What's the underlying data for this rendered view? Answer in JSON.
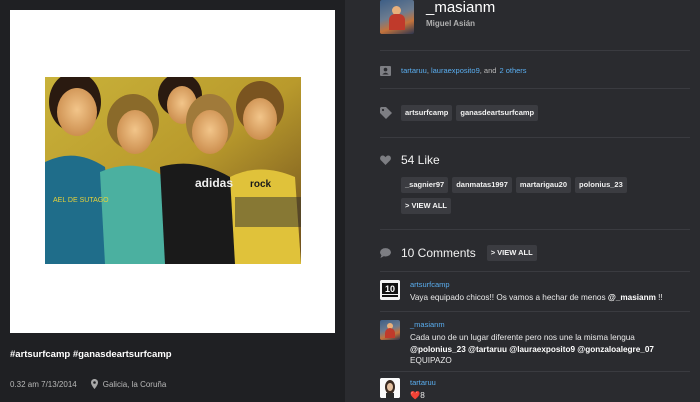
{
  "post": {
    "caption": "#artsurfcamp #ganasdeartsurfcamp",
    "time": "0.32 am 7/13/2014",
    "location": "Galicia, la Coruña"
  },
  "author": {
    "username": "_masianm",
    "real_name": "Miguel Asián"
  },
  "tagged": {
    "user1": "tartaruu",
    "sep1": ",",
    "user2": "lauraexposito9",
    "sep2": ", and",
    "others": "2 others"
  },
  "hashtags": [
    "artsurfcamp",
    "ganasdeartsurfcamp"
  ],
  "likes": {
    "label": "54 Like",
    "users": [
      "_sagnier97",
      "danmatas1997",
      "martarigau20",
      "polonius_23"
    ],
    "view_all": "> VIEW ALL"
  },
  "comments": {
    "label": "10 Comments",
    "view_all": "> VIEW ALL",
    "items": [
      {
        "user": "artsurfcamp",
        "text": "Vaya equipado chicos!! Os vamos a hechar de menos ",
        "mention": "@_masianm",
        "text_end": " !!"
      },
      {
        "user": "_masianm",
        "line1": "Cada uno de un lugar diferente pero nos une la misma lengua",
        "line2": "@polonius_23 @tartaruu @lauraexposito9 @gonzaloalegre_07",
        "line3": "EQUIPAZO"
      },
      {
        "user": "tartaruu",
        "emoji": "❤️",
        "suffix": "8"
      }
    ]
  },
  "colors": {
    "accent_link": "#5aaef0",
    "panel_left": "#1f2023",
    "panel_right": "#2a2b2f"
  }
}
